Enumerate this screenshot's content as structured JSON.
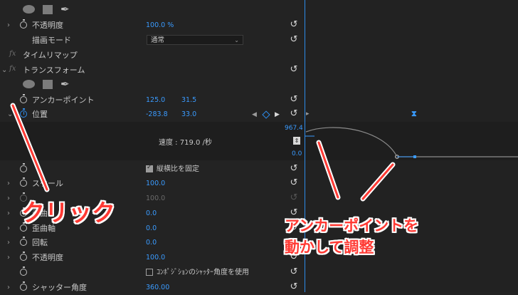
{
  "opacity_row": {
    "label": "不透明度",
    "value": "100.0 %"
  },
  "blend_row": {
    "label": "描画モード",
    "value": "通常"
  },
  "timeremap": {
    "fx": "fx",
    "label": "タイムリマップ"
  },
  "transform": {
    "fx": "fx",
    "label": "トランスフォーム"
  },
  "anchor": {
    "label": "アンカーポイント",
    "x": "125.0",
    "y": "31.5"
  },
  "position": {
    "label": "位置",
    "x": "-283.8",
    "y": "33.0"
  },
  "graph": {
    "speed": "速度 : 719.0 /秒",
    "max": "967.4",
    "min": "0.0"
  },
  "uniform": {
    "label": "縦横比を固定",
    "checked": true
  },
  "scale": {
    "label": "スケール",
    "value": "100.0"
  },
  "scale_w": {
    "value": "100.0"
  },
  "skew": {
    "label": "歪曲",
    "value": "0.0"
  },
  "skew_axis": {
    "label": "歪曲軸",
    "value": "0.0"
  },
  "rotation": {
    "label": "回転",
    "value": "0.0"
  },
  "opacity2": {
    "label": "不透明度",
    "value": "100.0"
  },
  "comp_shutter": {
    "label": "ｺﾝﾎﾟｼﾞｼｮﾝのｼｬｯﾀｰ角度を使用",
    "checked": false
  },
  "shutter": {
    "label": "シャッター角度",
    "value": "360.00"
  },
  "annotations": {
    "click": "クリック",
    "anchor_line1": "アンカーポイントを",
    "anchor_line2": "動かして調整"
  },
  "colors": {
    "accent": "#2d8ceb",
    "annotation": "#ff3a34",
    "background": "#232323"
  },
  "icons": [
    "ellipse-mask-icon",
    "rectangle-mask-icon",
    "pen-mask-icon",
    "stopwatch-icon",
    "reset-icon",
    "keyframe-diamond-icon"
  ]
}
